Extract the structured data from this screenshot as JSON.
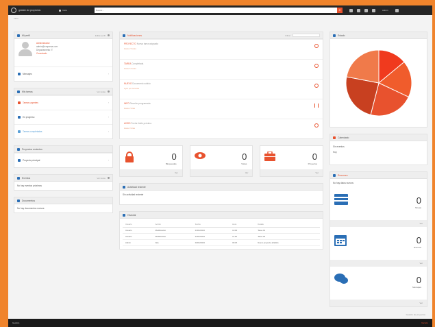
{
  "app": {
    "logo_text": "gestión de proyectos",
    "home_label": "Inicio"
  },
  "search": {
    "placeholder": "Buscar..."
  },
  "topbar": {
    "user_label": "Admin"
  },
  "breadcrumb": "Inicio",
  "left": {
    "user_panel": {
      "title": "Mi perfil",
      "link": "Editar perfil",
      "name": "Administrador",
      "line1": "admin@empresa.com",
      "line2": "Departamento IT",
      "status": "Conectado",
      "messages_label": "Mensajes"
    },
    "tasks_panel": {
      "title": "Mis tareas",
      "link": "Ver todas",
      "items": [
        "Tareas urgentes",
        "En progreso",
        "Tareas completadas"
      ]
    },
    "projects_panel": {
      "title": "Proyectos recientes",
      "item": "Proyecto principal"
    },
    "events_panel": {
      "title": "Eventos",
      "link": "Ver todos",
      "text": "No hay eventos próximos"
    },
    "docs_panel": {
      "title": "Documentos",
      "text": "No hay documentos nuevos"
    }
  },
  "mid": {
    "notifications_panel": {
      "title": "Notificaciones",
      "filter_label": "Filtrar",
      "items": [
        {
          "title": "PROYECTO",
          "detail": "Nueva tarea asignada",
          "sub": "Hace 2 horas"
        },
        {
          "title": "TAREA",
          "detail": "Completada",
          "sub": "Hace 5 horas"
        },
        {
          "title": "NUEVO",
          "detail": "Documento subido",
          "sub": "Ayer por la tarde"
        },
        {
          "title": "INFO",
          "detail": "Reunión programada",
          "sub": "Hace 2 días"
        },
        {
          "title": "AVISO",
          "detail": "Fecha límite próxima",
          "sub": "Hace 3 días"
        }
      ]
    },
    "stats": [
      {
        "icon": "lock-icon",
        "value": "0",
        "label": "Bloqueadas",
        "foot": "Ver"
      },
      {
        "icon": "eye-icon",
        "value": "0",
        "label": "Vistas",
        "foot": "Ver"
      },
      {
        "icon": "briefcase-icon",
        "value": "0",
        "label": "Proyectos",
        "foot": "Ver"
      }
    ],
    "activity_panel": {
      "title": "Actividad reciente",
      "text": "Sin actividad reciente"
    },
    "history_panel": {
      "title": "Historial",
      "columns": [
        "Usuario",
        "Acción",
        "Fecha",
        "Hora",
        "Detalle"
      ],
      "rows": [
        [
          "Usuario",
          "Modificación",
          "01/01/2023",
          "10:00",
          "Tarea 01"
        ],
        [
          "Usuario",
          "Modificación",
          "01/01/2023",
          "11:30",
          "Tarea 02"
        ],
        [
          "Admin",
          "Alta",
          "02/01/2023",
          "09:15",
          "Nuevo proyecto añadido"
        ]
      ]
    }
  },
  "right": {
    "chart_panel": {
      "title": "Estado"
    },
    "calendar_panel": {
      "title": "Calendario",
      "lines": [
        "Sin eventos",
        "Hoy"
      ]
    },
    "summary_panel": {
      "title": "Resumen",
      "text": "No hay datos nuevos"
    },
    "stats": [
      {
        "icon": "card-icon",
        "value": "0",
        "label": "Tareas",
        "foot": "Ver"
      },
      {
        "icon": "calendar-icon",
        "value": "0",
        "label": "Eventos",
        "foot": "Ver"
      },
      {
        "icon": "chat-icon",
        "value": "0",
        "label": "Mensajes",
        "foot": "Ver"
      }
    ]
  },
  "footer": {
    "text": "Gestión de proyectos",
    "bottom_logo": "Gestión",
    "bottom_right": "Versión"
  },
  "colors": {
    "accent": "#e8522e",
    "frame": "#f0842c",
    "topbar": "#262626",
    "blue": "#2a6eb5"
  },
  "chart_data": {
    "type": "pie",
    "values": [
      14,
      18,
      22,
      24,
      22
    ],
    "colors": [
      "#f03a1e",
      "#f05c2c",
      "#e8522e",
      "#c84020",
      "#f07a4a"
    ]
  }
}
